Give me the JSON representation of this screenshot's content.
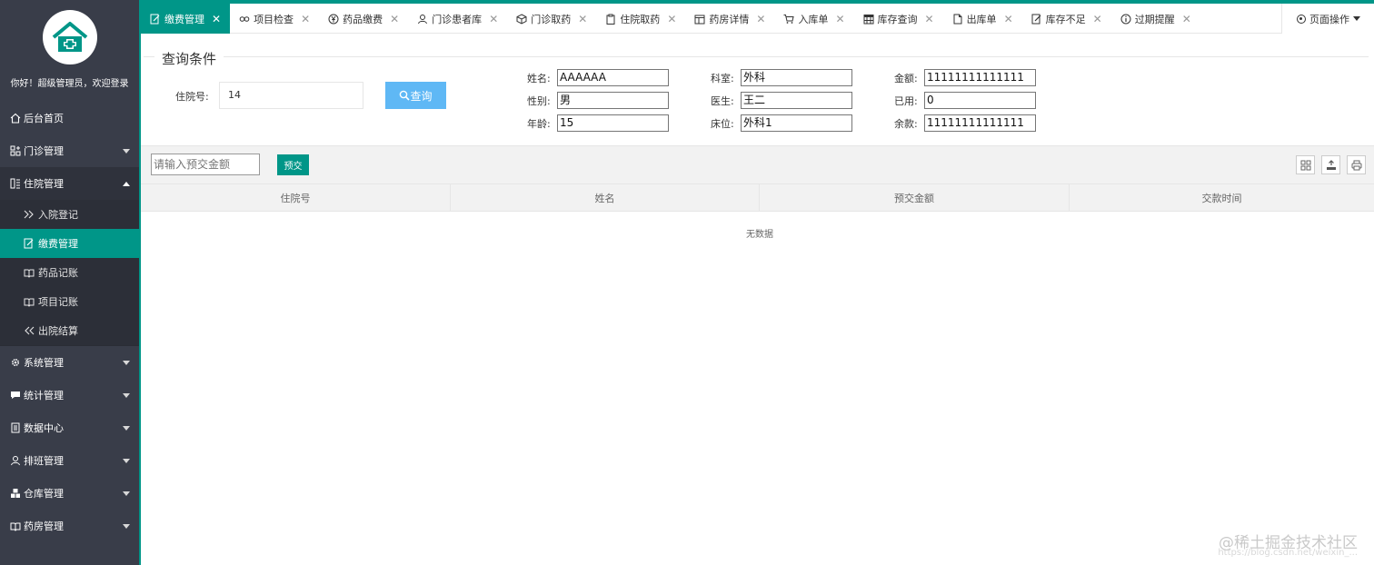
{
  "sidebar": {
    "welcome": "你好！超级管理员，欢迎登录",
    "items": [
      {
        "label": "后台首页",
        "icon": "home-icon"
      },
      {
        "label": "门诊管理",
        "icon": "grid-plus-icon"
      },
      {
        "label": "住院管理",
        "icon": "book-list-icon"
      },
      {
        "label": "系统管理",
        "icon": "gear-icon"
      },
      {
        "label": "统计管理",
        "icon": "chat-icon"
      },
      {
        "label": "数据中心",
        "icon": "database-icon"
      },
      {
        "label": "排班管理",
        "icon": "user-icon"
      },
      {
        "label": "仓库管理",
        "icon": "cubes-icon"
      },
      {
        "label": "药房管理",
        "icon": "open-book-icon"
      }
    ],
    "sub_items": [
      {
        "label": "入院登记",
        "icon": "double-chevron-right-icon"
      },
      {
        "label": "缴费管理",
        "icon": "edit-icon"
      },
      {
        "label": "药品记账",
        "icon": "open-book-icon"
      },
      {
        "label": "项目记账",
        "icon": "open-book-icon"
      },
      {
        "label": "出院结算",
        "icon": "double-chevron-left-icon"
      }
    ]
  },
  "tabs": [
    {
      "label": "缴费管理",
      "icon": "edit-icon",
      "active": true
    },
    {
      "label": "项目检查",
      "icon": "link-icon"
    },
    {
      "label": "药品缴费",
      "icon": "yen-icon"
    },
    {
      "label": "门诊患者库",
      "icon": "user-icon"
    },
    {
      "label": "门诊取药",
      "icon": "box-icon"
    },
    {
      "label": "住院取药",
      "icon": "clipboard-icon"
    },
    {
      "label": "药房详情",
      "icon": "calendar-icon"
    },
    {
      "label": "入库单",
      "icon": "cart-icon"
    },
    {
      "label": "库存查询",
      "icon": "calendar-grid-icon"
    },
    {
      "label": "出库单",
      "icon": "file-icon"
    },
    {
      "label": "库存不足",
      "icon": "edit-icon"
    },
    {
      "label": "过期提醒",
      "icon": "info-icon"
    }
  ],
  "page_ops": "页面操作",
  "query": {
    "legend": "查询条件",
    "hosp_no_label": "住院号:",
    "hosp_no_value": "14",
    "search_button": "查询"
  },
  "info": {
    "name_label": "姓名:",
    "name": "AAAAAA",
    "gender_label": "性别:",
    "gender": "男",
    "age_label": "年龄:",
    "age": "15",
    "dept_label": "科室:",
    "dept": "外科",
    "doctor_label": "医生:",
    "doctor": "王二",
    "bed_label": "床位:",
    "bed": "外科1",
    "amount_label": "金额:",
    "amount": "11111111111111",
    "used_label": "已用:",
    "used": "0",
    "balance_label": "余款:",
    "balance": "11111111111111"
  },
  "prepay": {
    "placeholder": "请输入预交金额",
    "button": "预交"
  },
  "table": {
    "headers": [
      "住院号",
      "姓名",
      "预交金额",
      "交款时间"
    ],
    "empty": "无数据"
  },
  "watermark": "@稀土掘金技术社区",
  "watermark_url": "https://blog.csdn.net/weixin_..."
}
